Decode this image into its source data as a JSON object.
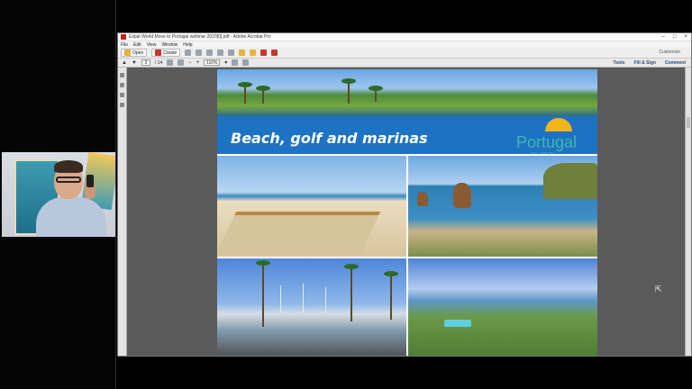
{
  "window": {
    "title": "Expat World Move to Portugal webinar 2020[0].pdf - Adobe Acrobat Pro",
    "controls": [
      "–",
      "□",
      "×"
    ]
  },
  "menu": [
    "File",
    "Edit",
    "View",
    "Window",
    "Help"
  ],
  "toolbar": {
    "open_label": "Open",
    "create_label": "Create",
    "customize_label": "Customize"
  },
  "nav": {
    "page_current": "3",
    "page_total": "/ 14",
    "zoom": "116%"
  },
  "right_links": [
    "Tools",
    "Fill & Sign",
    "Comment"
  ],
  "slide": {
    "title": "Beach, golf and marinas",
    "logo_text": "Portugal",
    "logo_sub": "visit · portugal"
  },
  "icons": {
    "open": "folder-icon",
    "create": "create-pdf-icon",
    "save": "save-icon",
    "print": "print-icon",
    "email": "email-icon",
    "prev_page": "up-arrow-icon",
    "next_page": "down-arrow-icon",
    "zoom_out": "minus-icon",
    "zoom_in": "plus-icon"
  }
}
